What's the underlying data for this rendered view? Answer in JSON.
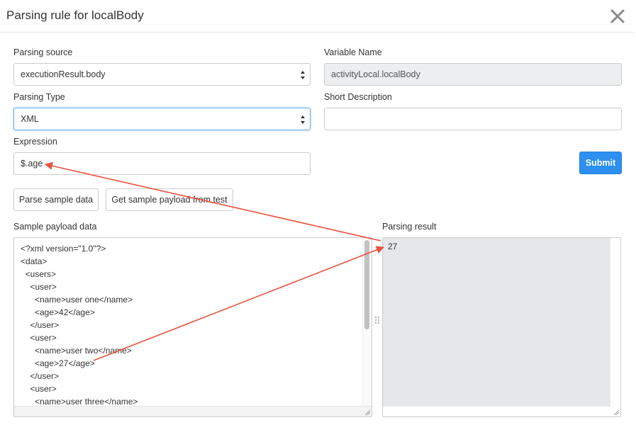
{
  "dialog": {
    "title": "Parsing rule for localBody"
  },
  "form": {
    "parsing_source": {
      "label": "Parsing source",
      "value": "executionResult.body"
    },
    "variable_name": {
      "label": "Variable Name",
      "value": "activityLocal.localBody"
    },
    "parsing_type": {
      "label": "Parsing Type",
      "value": "XML"
    },
    "short_description": {
      "label": "Short Description",
      "value": ""
    },
    "expression": {
      "label": "Expression",
      "value": "$.age"
    },
    "submit_label": "Submit"
  },
  "actions": {
    "parse_sample_label": "Parse sample data",
    "get_sample_label": "Get sample payload from test"
  },
  "sample": {
    "label": "Sample payload data",
    "lines": [
      "<?xml version=\"1.0\"?>",
      "<data>",
      "  <users>",
      "    <user>",
      "      <name>user one</name>",
      "      <age>42</age>",
      "    </user>",
      "    <user>",
      "      <name>user two</name>",
      "      <age>27</age>",
      "    </user>",
      "    <user>",
      "      <name>user three</name>"
    ]
  },
  "result": {
    "label": "Parsing result",
    "value": "27"
  },
  "colors": {
    "annotation_arrow": "#e8533f",
    "primary": "#2d8ff0"
  }
}
